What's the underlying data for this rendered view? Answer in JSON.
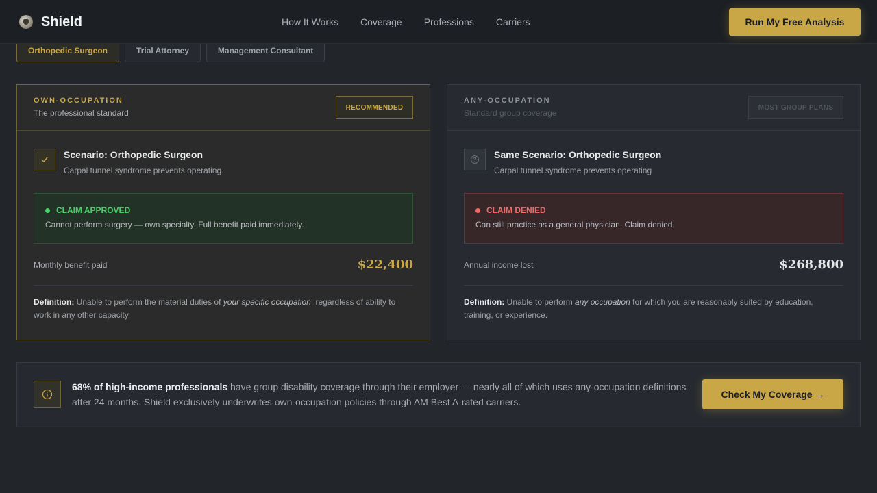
{
  "header": {
    "logo_text": "Shield",
    "logo_icon": "shield-logo-icon",
    "nav": [
      "How It Works",
      "Coverage",
      "Professions",
      "Carriers"
    ],
    "cta_label": "Run My Free Analysis"
  },
  "tabs": [
    {
      "label": "Orthopedic Surgeon",
      "active": true
    },
    {
      "label": "Trial Attorney",
      "active": false
    },
    {
      "label": "Management Consultant",
      "active": false
    }
  ],
  "own": {
    "kicker": "OWN-OCCUPATION",
    "subtitle": "The professional standard",
    "badge": "RECOMMENDED",
    "scenario_title": "Scenario: Orthopedic Surgeon",
    "scenario_sub": "Carpal tunnel syndrome prevents operating",
    "claim_title": "CLAIM APPROVED",
    "claim_text": "Cannot perform surgery — own specialty. Full benefit paid immediately.",
    "metric_label": "Monthly benefit paid",
    "metric_value": "$22,400",
    "def_label": "Definition:",
    "def_pre": " Unable to perform the material duties of ",
    "def_em": "your specific occupation",
    "def_post": ", regardless of ability to work in any other capacity.",
    "accent": "#c9a646"
  },
  "any": {
    "kicker": "ANY-OCCUPATION",
    "subtitle": "Standard group coverage",
    "badge": "MOST GROUP PLANS",
    "scenario_title": "Same Scenario: Orthopedic Surgeon",
    "scenario_sub": "Carpal tunnel syndrome prevents operating",
    "claim_title": "CLAIM DENIED",
    "claim_text": "Can still practice as a general physician. Claim denied.",
    "metric_label": "Annual income lost",
    "metric_value": "$268,800",
    "def_label": "Definition:",
    "def_pre": " Unable to perform ",
    "def_em": "any occupation",
    "def_post": " for which you are reasonably suited by education, training, or experience.",
    "denied_color": "#ef6b6b"
  },
  "banner": {
    "bold": "68% of high-income professionals",
    "text": " have group disability coverage through their employer — nearly all of which uses any-occupation definitions after 24 months. Shield exclusively underwrites own-occupation policies through AM Best A-rated carriers.",
    "cta_label": "Check My Coverage →"
  }
}
